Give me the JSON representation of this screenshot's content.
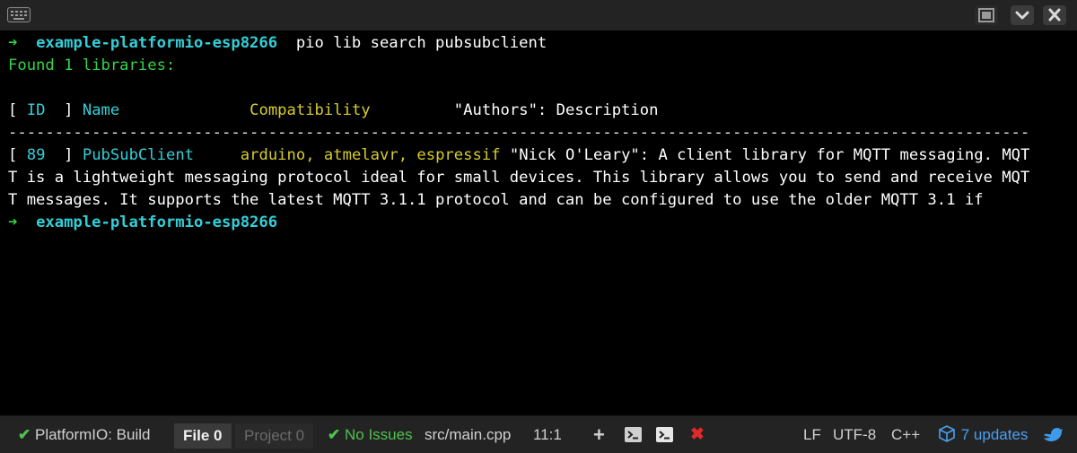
{
  "window": {
    "colors": {
      "prompt_arrow": "#33d44a",
      "prompt_dir": "#33cfd8",
      "success": "#33d44a",
      "compat": "#d6cc2c",
      "background": "#000000",
      "statusbar_bg": "#232323",
      "link_blue": "#4a9ff0",
      "error_red": "#e0292b"
    },
    "icons": {
      "keyboard": "keyboard-icon",
      "maximize": "maximize-icon",
      "dropdown": "chevron-down-icon",
      "close": "close-icon"
    }
  },
  "terminal": {
    "prompt_arrow": "➜",
    "prompt1_dir": "example-platformio-esp8266",
    "prompt1_cmd": "pio lib search pubsubclient",
    "found_text": "Found 1 libraries:",
    "header": {
      "open_bracket": "[",
      "id": "ID",
      "close_bracket": "]",
      "name": "Name",
      "compatibility": "Compatibility",
      "authors_desc": "\"Authors\": Description"
    },
    "separator": "--------------------------------------------------------------------------------------------------------------",
    "result": {
      "open_bracket": "[",
      "id": "89",
      "close_bracket": "]",
      "name": "PubSubClient",
      "compatibility": "arduino, atmelavr, espressif",
      "desc_line1": "\"Nick O'Leary\": A client library for MQTT messaging. MQT",
      "desc_line2": "T is a lightweight messaging protocol ideal for small devices. This library allows you to send and receive MQT",
      "desc_line3": "T messages. It supports the latest MQTT 3.1.1 protocol and can be configured to use the older MQTT 3.1 if"
    },
    "prompt2_dir": "example-platformio-esp8266"
  },
  "statusbar": {
    "build_check": "✔",
    "build_label": "PlatformIO: Build",
    "tab_file_label": "File",
    "tab_file_count": "0",
    "tab_project_label": "Project",
    "tab_project_count": "0",
    "issues_check": "✔",
    "issues_label": "No Issues",
    "file_path": "src/main.cpp",
    "cursor_position": "11:1",
    "add_label": "+",
    "close_label": "✖",
    "line_ending": "LF",
    "encoding": "UTF-8",
    "grammar": "C++",
    "updates_label": "7 updates",
    "icons": {
      "terminal1": "terminal-icon",
      "terminal2": "terminal-icon",
      "package": "package-icon",
      "bird": "bird-icon"
    }
  }
}
